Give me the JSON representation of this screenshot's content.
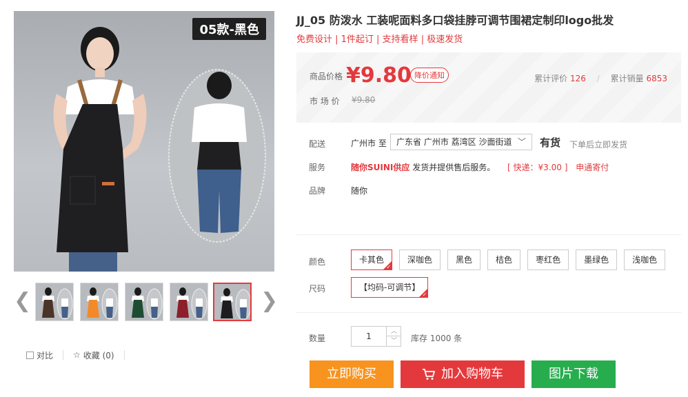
{
  "gallery": {
    "badge": "05款-黑色",
    "prev": "❮",
    "next": "❯",
    "thumbs": [
      {
        "label": "咖啡色",
        "apron_color": "#4a3327"
      },
      {
        "label": "桔色",
        "apron_color": "#f28a2a"
      },
      {
        "label": "墨绿色",
        "apron_color": "#1f4d34"
      },
      {
        "label": "枣红色",
        "apron_color": "#8c1f2a"
      },
      {
        "label": "黑色",
        "apron_color": "#1d1d20",
        "active": true
      }
    ],
    "compare": "对比",
    "favorite": "收藏 (0)"
  },
  "product": {
    "title": "JJ_05 防泼水 工装呢面料多口袋挂脖可调节围裙定制印logo批发",
    "promo": "免费设计 | 1件起订 | 支持看样 | 极速发货"
  },
  "price": {
    "label": "商品价格",
    "value": "¥9.80",
    "notify": "降价通知",
    "market_label": "市 场 价",
    "market_value": "¥9.80",
    "review_label": "累计评价",
    "review_count": "126",
    "sales_label": "累计销量",
    "sales_count": "6853"
  },
  "delivery": {
    "label": "配送",
    "from": "广州市 至",
    "address": "广东省 广州市 荔湾区 沙面街道",
    "stock": "有货",
    "stock_note": "下单后立即发货"
  },
  "service": {
    "label": "服务",
    "shop": "随你SUINI供应",
    "text": "发货并提供售后服务。",
    "shipping": "[ 快递：¥3.00 ]",
    "region": "申通寄付"
  },
  "brand": {
    "label": "品牌",
    "value": "随你"
  },
  "color": {
    "label": "颜色",
    "options": [
      "卡其色",
      "深咖色",
      "黑色",
      "桔色",
      "枣红色",
      "墨绿色",
      "浅咖色"
    ],
    "selected": 0
  },
  "size": {
    "label": "尺码",
    "options": [
      "【均码-可调节】"
    ],
    "selected": 0
  },
  "quantity": {
    "label": "数量",
    "value": "1",
    "inventory": "库存 1000 条"
  },
  "actions": {
    "buy": "立即购买",
    "cart": "加入购物车",
    "download": "图片下载"
  },
  "colors": {
    "accent": "#e4393c",
    "buy": "#f7931e",
    "download": "#27ad4e"
  }
}
